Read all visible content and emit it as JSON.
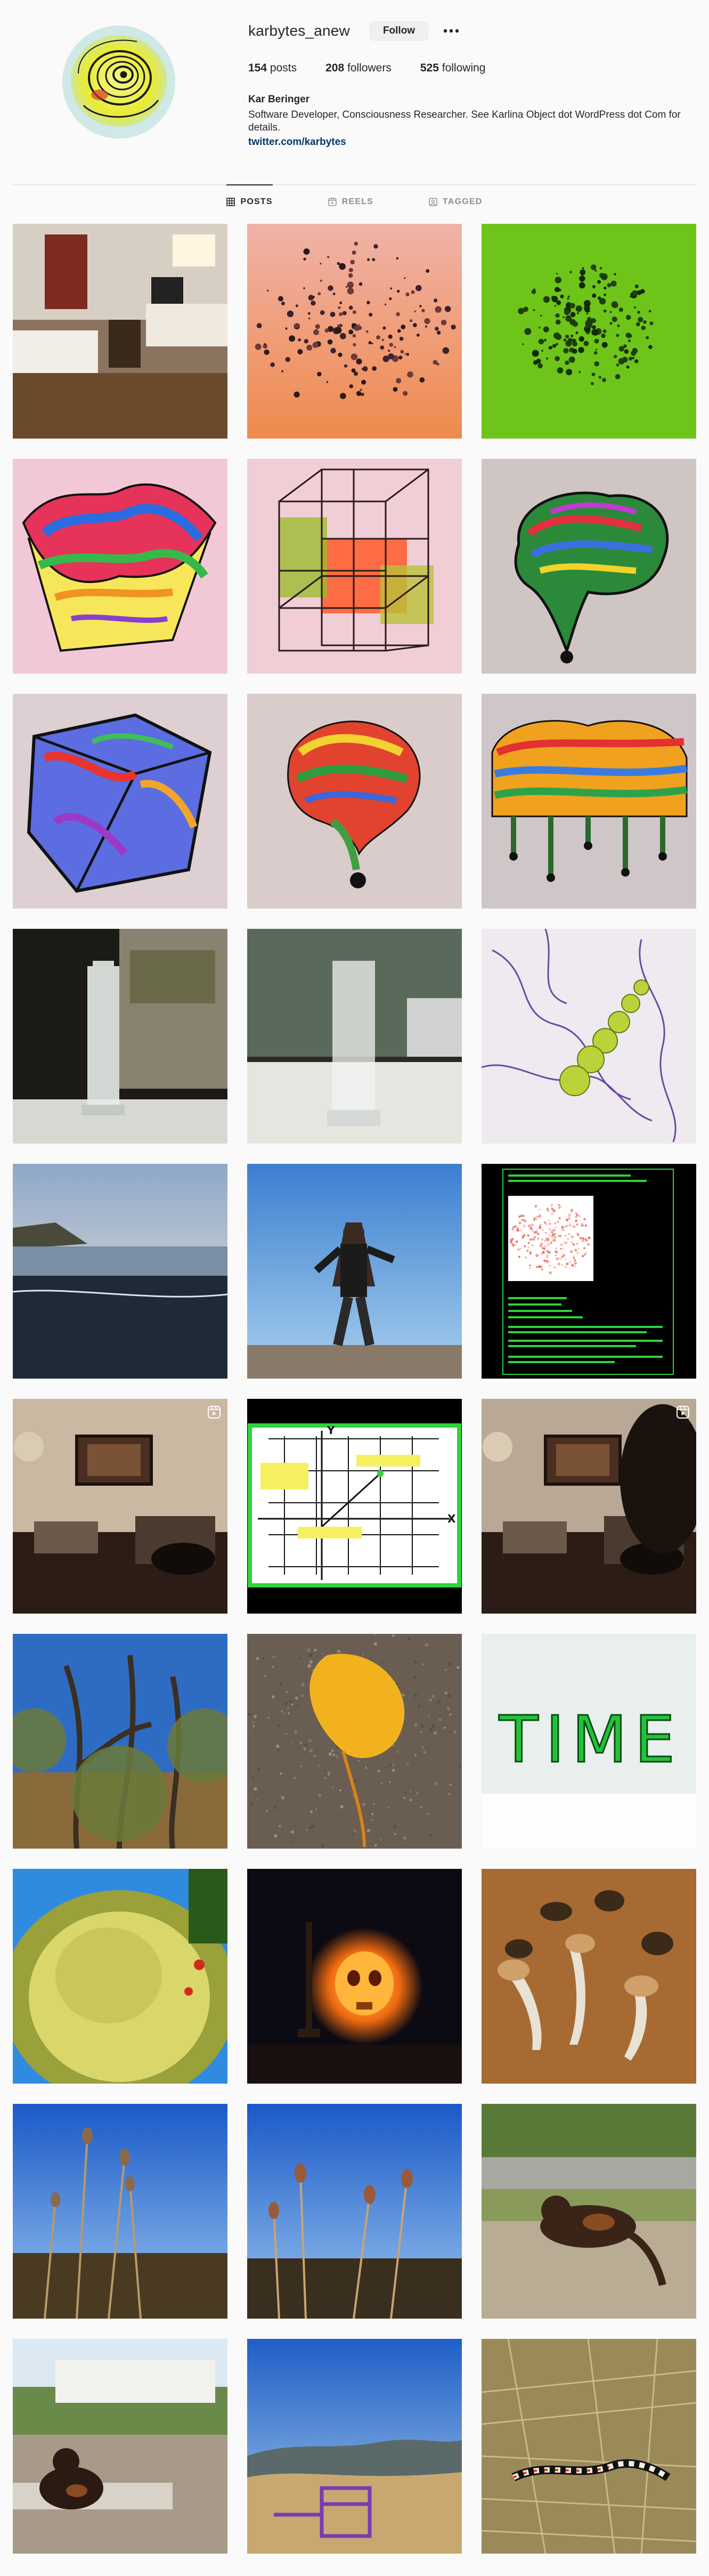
{
  "profile": {
    "username": "karbytes_anew",
    "follow_label": "Follow",
    "more_label": "More options",
    "stats": {
      "posts_count": "154",
      "posts_label": "posts",
      "followers_count": "208",
      "followers_label": "followers",
      "following_count": "525",
      "following_label": "following"
    },
    "full_name": "Kar Beringer",
    "bio": "Software Developer, Consciousness Researcher. See Karlina Object dot WordPress dot Com for details.",
    "link": "twitter.com/karbytes"
  },
  "tabs": [
    {
      "label": "POSTS",
      "icon": "grid-icon",
      "active": true
    },
    {
      "label": "REELS",
      "icon": "reels-icon",
      "active": false
    },
    {
      "label": "TAGGED",
      "icon": "tagged-icon",
      "active": false
    }
  ],
  "posts": [
    {
      "scene": "hotel-room",
      "reel": false
    },
    {
      "scene": "dots-orange",
      "reel": false
    },
    {
      "scene": "dots-green",
      "reel": false
    },
    {
      "scene": "psychedelic-cube",
      "reel": false
    },
    {
      "scene": "tesseract",
      "reel": false
    },
    {
      "scene": "psychedelic-brain",
      "reel": false
    },
    {
      "scene": "stained-cube",
      "reel": false
    },
    {
      "scene": "swirl-drip",
      "reel": false
    },
    {
      "scene": "drip-cloud",
      "reel": false
    },
    {
      "scene": "glass-window-1",
      "reel": false
    },
    {
      "scene": "glass-window-2",
      "reel": false
    },
    {
      "scene": "purple-doodle",
      "reel": false
    },
    {
      "scene": "beach",
      "reel": false
    },
    {
      "scene": "person-rock",
      "reel": false
    },
    {
      "scene": "terminal",
      "reel": false
    },
    {
      "scene": "room-1",
      "reel": true
    },
    {
      "scene": "graph",
      "reel": false
    },
    {
      "scene": "room-2",
      "reel": true
    },
    {
      "scene": "trees",
      "reel": false
    },
    {
      "scene": "leaf",
      "reel": false
    },
    {
      "scene": "time",
      "reel": false
    },
    {
      "scene": "bush",
      "reel": false
    },
    {
      "scene": "skull",
      "reel": false
    },
    {
      "scene": "mushrooms",
      "reel": false
    },
    {
      "scene": "teasel-1",
      "reel": false
    },
    {
      "scene": "teasel-2",
      "reel": false
    },
    {
      "scene": "cat-1",
      "reel": false
    },
    {
      "scene": "cat-2",
      "reel": false
    },
    {
      "scene": "hills",
      "reel": false
    },
    {
      "scene": "snake",
      "reel": false
    }
  ],
  "post_text": {
    "time_word": "TIME",
    "graph_axis_x": "X",
    "graph_axis_y": "Y"
  },
  "colors": {
    "link": "#00376b",
    "follow_bg": "#efefef",
    "tab_active": "#262626",
    "tab_inactive": "#8e8e8e",
    "background": "#fafafa"
  }
}
